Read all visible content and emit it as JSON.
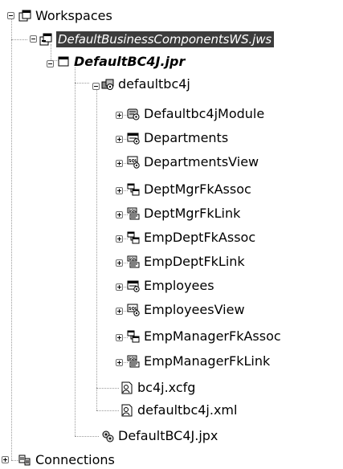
{
  "tree": {
    "workspaces": {
      "label": "Workspaces",
      "icon": "workspaces-icon"
    },
    "workspace": {
      "label": "DefaultBusinessComponentsWS.jws",
      "icon": "workspace-icon"
    },
    "project": {
      "label": "DefaultBC4J.jpr",
      "icon": "project-icon"
    },
    "package": {
      "label": "defaultbc4j",
      "icon": "package-icon"
    },
    "items": [
      {
        "label": "Defaultbc4jModule",
        "icon": "application-module-icon"
      },
      {
        "label": "Departments",
        "icon": "entity-object-icon"
      },
      {
        "label": "DepartmentsView",
        "icon": "view-object-icon"
      },
      {
        "label": "DeptMgrFkAssoc",
        "icon": "association-icon"
      },
      {
        "label": "DeptMgrFkLink",
        "icon": "view-link-icon"
      },
      {
        "label": "EmpDeptFkAssoc",
        "icon": "association-icon"
      },
      {
        "label": "EmpDeptFkLink",
        "icon": "view-link-icon"
      },
      {
        "label": "Employees",
        "icon": "entity-object-icon"
      },
      {
        "label": "EmployeesView",
        "icon": "view-object-icon"
      },
      {
        "label": "EmpManagerFkAssoc",
        "icon": "association-icon"
      },
      {
        "label": "EmpManagerFkLink",
        "icon": "view-link-icon"
      },
      {
        "label": "bc4j.xcfg",
        "icon": "config-file-icon"
      },
      {
        "label": "defaultbc4j.xml",
        "icon": "xml-file-icon"
      }
    ],
    "project_file": {
      "label": "DefaultBC4J.jpx",
      "icon": "project-config-icon"
    },
    "connections": {
      "label": "Connections",
      "icon": "connections-icon"
    }
  }
}
